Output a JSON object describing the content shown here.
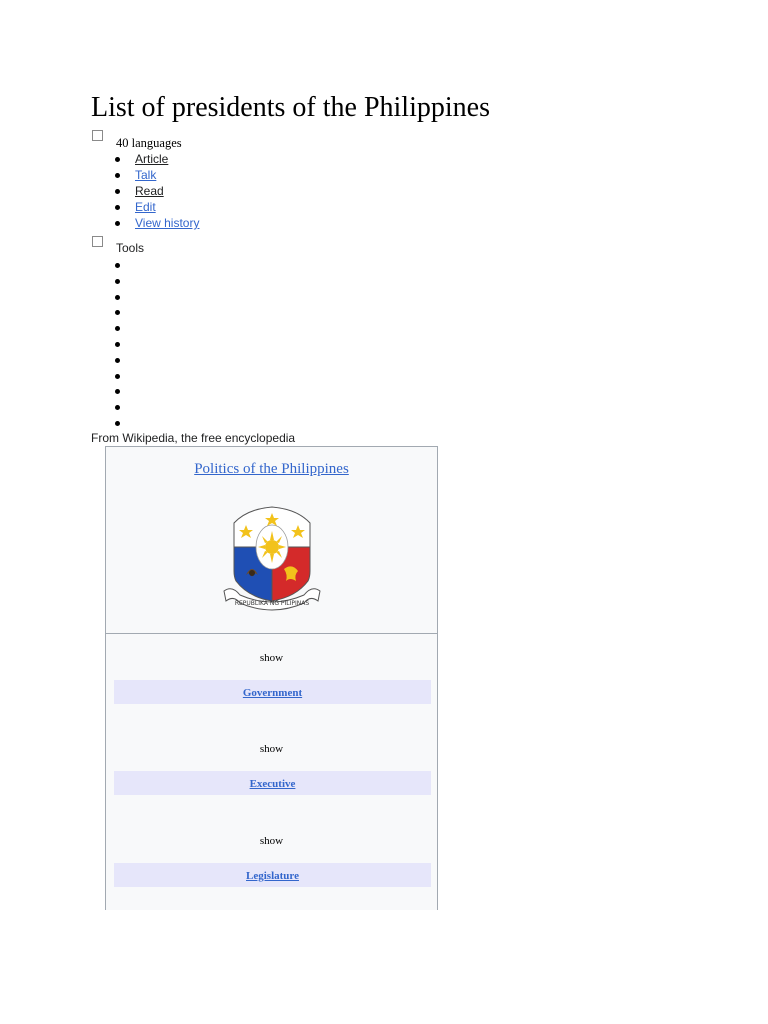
{
  "page": {
    "title": "List of presidents of the Philippines",
    "tagline": "From Wikipedia, the free encyclopedia"
  },
  "languages": {
    "label": "40 languages"
  },
  "tabs": [
    {
      "label": "Article"
    },
    {
      "label": "Talk"
    },
    {
      "label": "Read"
    },
    {
      "label": "Edit"
    },
    {
      "label": "View history"
    }
  ],
  "tools": {
    "label": "Tools",
    "empty_item_count": 11
  },
  "sidebar": {
    "title": "Politics of the Philippines",
    "emblem_icon": "coat-of-arms-philippines-icon",
    "emblem_text": "REPUBLIKA NG PILIPINAS",
    "sections": [
      {
        "toggle": "show",
        "label": "Government"
      },
      {
        "toggle": "show",
        "label": "Executive"
      },
      {
        "toggle": "show",
        "label": "Legislature"
      }
    ]
  },
  "colors": {
    "link": "#3366cc",
    "section_bg": "#e6e6fa",
    "sidebar_bg": "#f8f9fa",
    "border": "#a2a9b1"
  }
}
